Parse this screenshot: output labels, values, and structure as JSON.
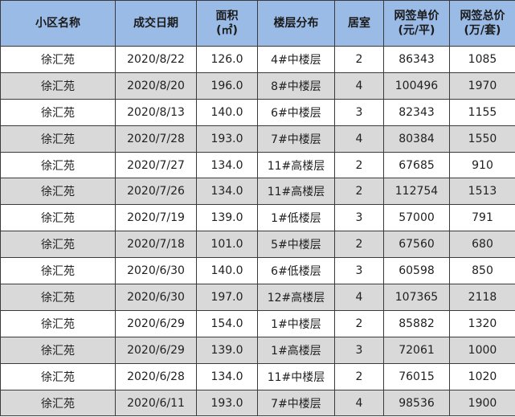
{
  "headers": {
    "name": "小区名称",
    "date": "成交日期",
    "area_line1": "面积",
    "area_line2": "(㎡)",
    "floor": "楼层分布",
    "rooms": "居室",
    "price_line1": "网签单价",
    "price_line2": "(元/平)",
    "total_line1": "网签总价",
    "total_line2": "(万/套)"
  },
  "rows": [
    {
      "name": "徐汇苑",
      "date": "2020/8/22",
      "area": "126.0",
      "floor": "4#中楼层",
      "rooms": "2",
      "price": "86343",
      "total": "1085"
    },
    {
      "name": "徐汇苑",
      "date": "2020/8/20",
      "area": "196.0",
      "floor": "8#中楼层",
      "rooms": "4",
      "price": "100496",
      "total": "1970"
    },
    {
      "name": "徐汇苑",
      "date": "2020/8/13",
      "area": "140.0",
      "floor": "6#中楼层",
      "rooms": "3",
      "price": "82343",
      "total": "1155"
    },
    {
      "name": "徐汇苑",
      "date": "2020/7/28",
      "area": "193.0",
      "floor": "7#中楼层",
      "rooms": "4",
      "price": "80384",
      "total": "1550"
    },
    {
      "name": "徐汇苑",
      "date": "2020/7/27",
      "area": "134.0",
      "floor": "11#高楼层",
      "rooms": "2",
      "price": "67685",
      "total": "910"
    },
    {
      "name": "徐汇苑",
      "date": "2020/7/26",
      "area": "134.0",
      "floor": "11#高楼层",
      "rooms": "2",
      "price": "112754",
      "total": "1513"
    },
    {
      "name": "徐汇苑",
      "date": "2020/7/19",
      "area": "139.0",
      "floor": "1#低楼层",
      "rooms": "3",
      "price": "57000",
      "total": "791"
    },
    {
      "name": "徐汇苑",
      "date": "2020/7/18",
      "area": "101.0",
      "floor": "5#中楼层",
      "rooms": "2",
      "price": "67560",
      "total": "680"
    },
    {
      "name": "徐汇苑",
      "date": "2020/6/30",
      "area": "140.0",
      "floor": "6#低楼层",
      "rooms": "3",
      "price": "60598",
      "total": "850"
    },
    {
      "name": "徐汇苑",
      "date": "2020/6/30",
      "area": "197.0",
      "floor": "12#高楼层",
      "rooms": "4",
      "price": "107365",
      "total": "2118"
    },
    {
      "name": "徐汇苑",
      "date": "2020/6/29",
      "area": "154.0",
      "floor": "1#中楼层",
      "rooms": "2",
      "price": "85882",
      "total": "1320"
    },
    {
      "name": "徐汇苑",
      "date": "2020/6/29",
      "area": "139.0",
      "floor": "1#高楼层",
      "rooms": "3",
      "price": "72061",
      "total": "1000"
    },
    {
      "name": "徐汇苑",
      "date": "2020/6/28",
      "area": "134.0",
      "floor": "11#中楼层",
      "rooms": "2",
      "price": "76015",
      "total": "1020"
    },
    {
      "name": "徐汇苑",
      "date": "2020/6/11",
      "area": "193.0",
      "floor": "7#中楼层",
      "rooms": "4",
      "price": "98536",
      "total": "1900"
    }
  ]
}
